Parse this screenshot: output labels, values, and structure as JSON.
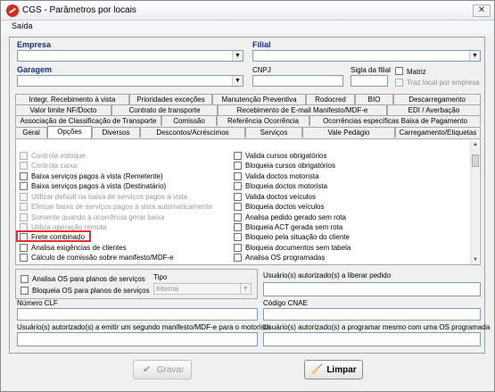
{
  "window": {
    "title": "CGS - Parâmetros por locais",
    "close_glyph": "✕"
  },
  "menu": {
    "saida": "Saída"
  },
  "header": {
    "empresa_label": "Empresa",
    "filial_label": "Filial",
    "garagem_label": "Garagem",
    "cnpj_label": "CNPJ",
    "sigla_label": "Sigla da filial",
    "matriz_label": "Matriz",
    "traz_local_label": "Traz local por empresa"
  },
  "tabs": {
    "row1": [
      "Integr. Recebimento à vista",
      "Prioridades exceções",
      "Manutenção Preventiva",
      "Rodocred",
      "BIO",
      "Descarregamento"
    ],
    "row2": [
      "Valor limite NF/Docto",
      "Contrato de transporte",
      "Recebimento de E-mail Manifesto/MDF-e",
      "EDI / Averbação"
    ],
    "row3": [
      "Associação de Classificação de Transporte",
      "Comissão",
      "Referência Ocorrência",
      "Ocorrências específicas Baixa de Pagamento"
    ],
    "row4": [
      "Geral",
      "Opções",
      "Diversos",
      "Descontos/Acréscimos",
      "Serviços",
      "Vale Pedágio",
      "Carregamento/Etiquetas"
    ],
    "active": "Opções"
  },
  "options_left": [
    "Controla estoque",
    "Controla caixa",
    "Baixa serviços pagos à vista (Remetente)",
    "Baixa serviços pagos à vista (Destinatário)",
    "Utilizar default na baixa de serviços pagos à vista",
    "Efetuar baixa de serviços pagos à vista automaticamente",
    "Somente quando a ocorrência gerar baixa",
    "Utiliza operação remota",
    "Frete combinado",
    "Analisa exigências de clientes",
    "Cálculo de comissão sobre manifesto/MDF-e"
  ],
  "options_right": [
    "Valida cursos obrigatórios",
    "Bloqueia cursos obrigatórios",
    "Valida doctos motorista",
    "Bloqueia doctos motorista",
    "Valida doctos veículos",
    "Bloqueia doctos veículos",
    "Analisa pedido gerado sem rota",
    "Bloqueia ACT gerada sem rota",
    "Bloqueio pela situação do cliente",
    "Bloqueia documentos sem tabela",
    "Analisa OS programadas"
  ],
  "lower": {
    "analisa_os": "Analisa OS para planos de serviços",
    "bloqueia_os": "Bloqueia OS para planos de serviços",
    "tipo_label": "Tipo",
    "tipo_value": "Interna",
    "liberar_pedido_label": "Usuário(s) autorizado(s) a liberar pedido",
    "numero_clf_label": "Número CLF",
    "codigo_cnae_label": "Código CNAE",
    "segundo_manifesto_label": "Usuário(s) autorizado(s) a emitir um segundo manifesto/MDF-e para o motorista",
    "programar_os_label": "Usuário(s) autorizado(s) a programar mesmo com uma OS programada"
  },
  "buttons": {
    "gravar": "Gravar",
    "limpar": "Limpar"
  },
  "colors": {
    "highlight": "#e53030",
    "bold_label": "#1a2d82"
  }
}
